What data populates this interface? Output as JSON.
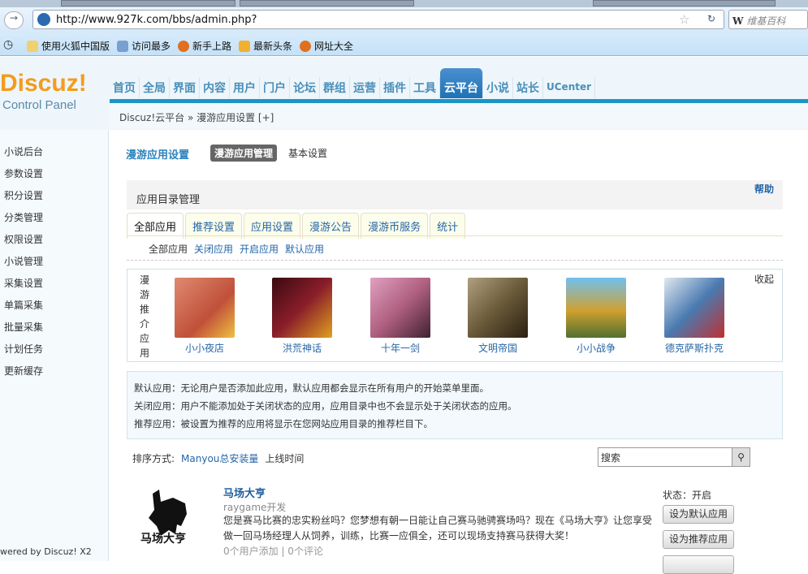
{
  "browser": {
    "url": "http://www.927k.com/bbs/admin.php?",
    "search_placeholder": "维基百科",
    "search_engine": "W",
    "bookmarks": [
      "使用火狐中国版",
      "访问最多",
      "新手上路",
      "最新头条",
      "网址大全"
    ]
  },
  "logo": {
    "title": "Discuz!",
    "subtitle": "Control Panel"
  },
  "nav": [
    "首页",
    "全局",
    "界面",
    "内容",
    "用户",
    "门户",
    "论坛",
    "群组",
    "运营",
    "插件",
    "工具",
    "云平台",
    "小说",
    "站长",
    "UCenter"
  ],
  "nav_active": "云平台",
  "breadcrumb": "Discuz!云平台 » 漫游应用设置  [+]",
  "sidebar": [
    "小说后台",
    "参数设置",
    "积分设置",
    "分类管理",
    "权限设置",
    "小说管理",
    "采集设置",
    "单篇采集",
    "批量采集",
    "计划任务",
    "更新缓存"
  ],
  "footer": "wered by Discuz! X2",
  "main": {
    "title": "漫游应用设置",
    "tab_active": "漫游应用管理",
    "tab_basic": "基本设置",
    "box_title": "应用目录管理",
    "help": "帮助",
    "tabs": [
      "全部应用",
      "推荐设置",
      "应用设置",
      "漫游公告",
      "漫游币服务",
      "统计"
    ],
    "subtabs": [
      "全部应用",
      "关闭应用",
      "开启应用",
      "默认应用"
    ],
    "recommended_title": "漫游推介应用",
    "collapse": "收起",
    "recommended": [
      {
        "name": "小小夜店",
        "color": "#c0503a"
      },
      {
        "name": "洪荒神话",
        "color": "#8a1e2a"
      },
      {
        "name": "十年一剑",
        "color": "#b06080"
      },
      {
        "name": "文明帝国",
        "color": "#6a5a3a"
      },
      {
        "name": "小小战争",
        "color": "#d0a030"
      },
      {
        "name": "德克萨斯扑克",
        "color": "#4a7ab0"
      }
    ],
    "info": [
      "默认应用：无论用户是否添加此应用，默认应用都会显示在所有用户的开始菜单里面。",
      "关闭应用：用户不能添加处于关闭状态的应用，应用目录中也不会显示处于关闭状态的应用。",
      "推荐应用：被设置为推荐的应用将显示在您网站应用目录的推荐栏目下。"
    ],
    "sort_label": "排序方式:",
    "sort_options": [
      "Manyou总安装量",
      "上线时间"
    ],
    "search_value": "搜索",
    "app": {
      "name": "马场大亨",
      "logo_text": "马场大亨",
      "developer": "raygame开发",
      "description": "您是赛马比赛的忠实粉丝吗？您梦想有朝一日能让自己赛马驰骋赛场吗？现在《马场大亨》让您享受做一回马场经理人从饲养，训练，比赛一应俱全，还可以现场支持赛马获得大奖！",
      "stats": "0个用户添加 | 0个评论",
      "status": "状态：开启",
      "btn_default": "设为默认应用",
      "btn_recommend": "设为推荐应用"
    }
  }
}
